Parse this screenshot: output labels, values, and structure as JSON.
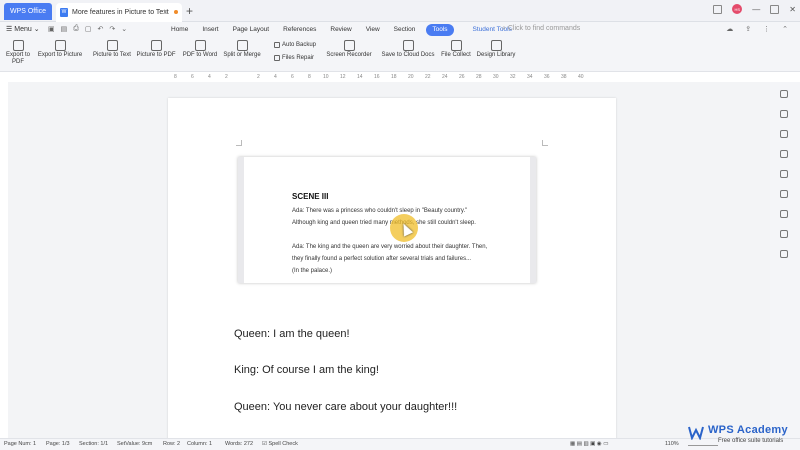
{
  "titlebar": {
    "home_tab": "WPS Office",
    "doc_tab": "More features in Picture to Text",
    "doc_icon": "W",
    "avatar_text": "HS"
  },
  "menubar": {
    "menu_label": "Menu",
    "tabs": [
      "Home",
      "Insert",
      "Page Layout",
      "References",
      "Review",
      "View",
      "Section",
      "Tools"
    ],
    "active_tab": "Tools",
    "student_tab": "Student Tools",
    "search_placeholder": "Click to find commands"
  },
  "ribbon": {
    "items": [
      "Export to PDF",
      "Export to Picture",
      "Picture to Text",
      "Picture to PDF",
      "PDF to Word",
      "Split or Merge",
      "Screen Recorder",
      "Save to Cloud Docs",
      "File Collect",
      "Design Library"
    ],
    "small_items": [
      "Auto Backup",
      "Files Repair"
    ]
  },
  "ruler": {
    "numbers": [
      "8",
      "6",
      "4",
      "2",
      "2",
      "4",
      "6",
      "8",
      "10",
      "12",
      "14",
      "16",
      "18",
      "20",
      "22",
      "24",
      "26",
      "28",
      "30",
      "32",
      "34",
      "36",
      "38",
      "40"
    ]
  },
  "video": {
    "title": "SCENE III",
    "lines": [
      "Ada: There was a princess who couldn't sleep in \"Beauty country.\"",
      "Although king and queen tried many methods, she still couldn't sleep.",
      "Ada: The king and the queen are very worried about their daughter. Then,",
      "they finally found a perfect solution after several trials and failures...",
      "(In the palace.)"
    ]
  },
  "document": {
    "lines": [
      "Queen: I am the queen!",
      "King: Of course I am the king!",
      "Queen: You never care about your daughter!!!"
    ]
  },
  "statusbar": {
    "page_num": "Page Num: 1",
    "page": "Page: 1/3",
    "section": "Section: 1/1",
    "set_value": "SetValue: 9cm",
    "row": "Row: 2",
    "column": "Column: 1",
    "words": "Words: 272",
    "spell_check": "Spell Check",
    "zoom": "110%"
  },
  "watermark": {
    "title": "WPS Academy",
    "subtitle": "Free office suite tutorials"
  }
}
